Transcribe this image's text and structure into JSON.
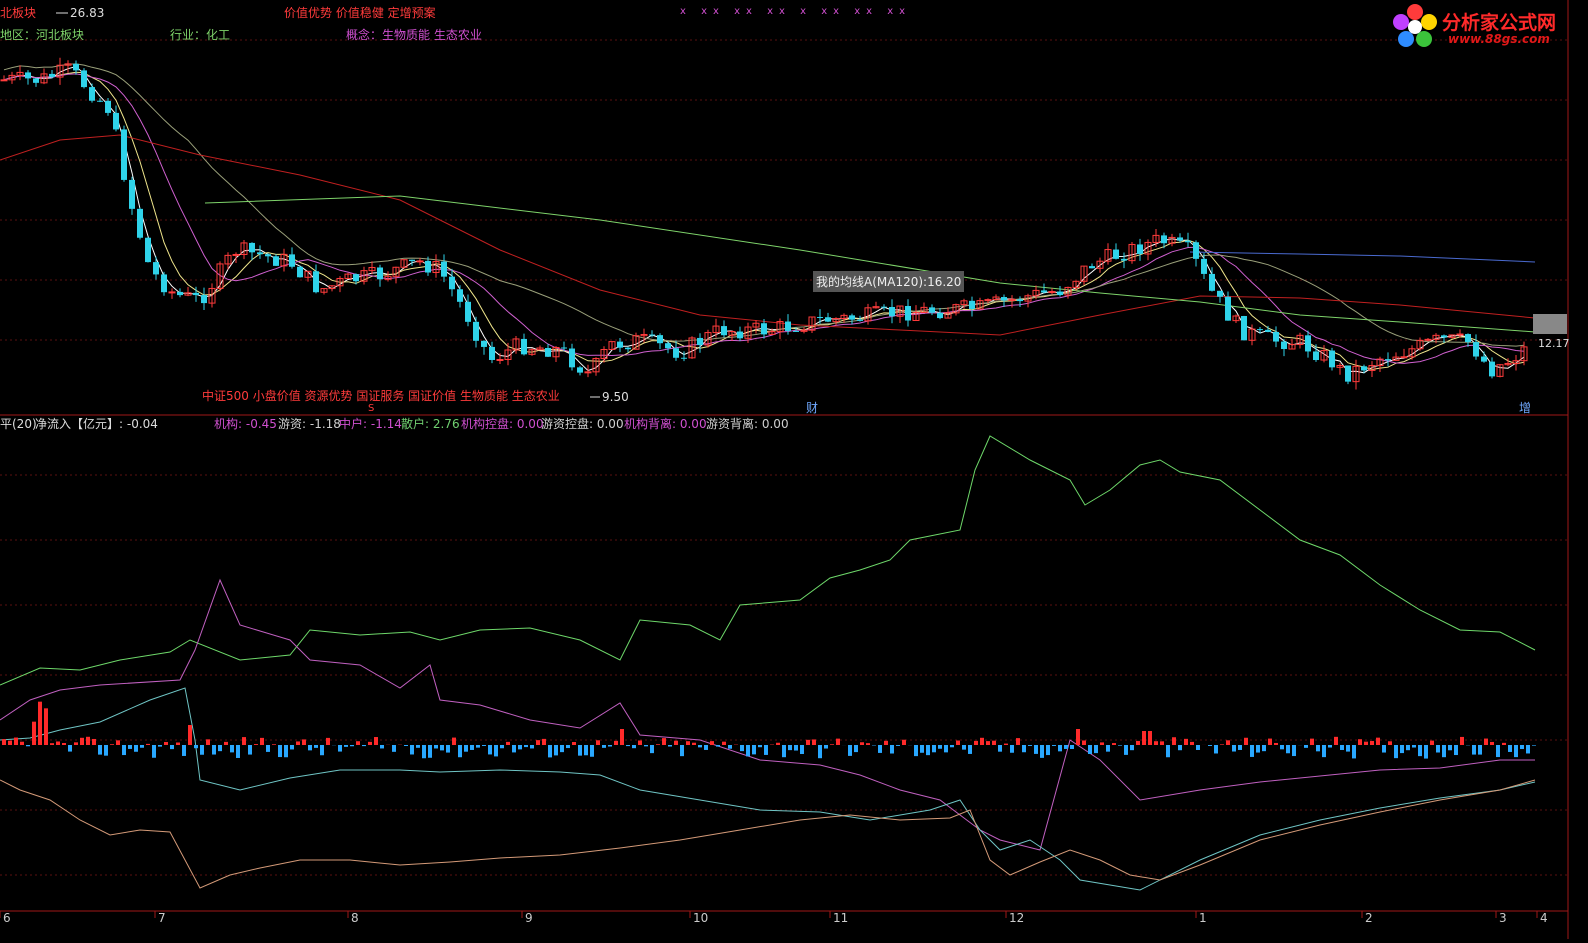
{
  "header": {
    "region_badge": "北板块",
    "price_high_label": "26.83",
    "concept_tags": "价值优势 价值稳健 定增预案",
    "region": "地区：河北板块",
    "industry": "行业：化工",
    "concept": "概念：生物质能 生态农业",
    "marks": "x  xx  xx xx  x xx  xx xx"
  },
  "logo": {
    "title": "分析家公式网",
    "url": "www.88gs.com"
  },
  "price_panel": {
    "ma_tooltip": "我的均线A(MA120):16.20",
    "low_label": "9.50",
    "last_price_label": "12.17",
    "index_tags": "中证500 小盘价值 资源优势 国证服务 国证价值 生物质能 生态农业",
    "event_mark_s": "S",
    "event_mark_cai": "财",
    "event_mark_tui": "增",
    "colors": {
      "bg": "#000000",
      "up": "#ff3b3b",
      "down": "#2fd3ea",
      "ma_white": "#ffffff",
      "ma_yellow": "#f0e68c",
      "ma_magenta": "#d060d0",
      "ma_green": "#7ed36a",
      "ma_red": "#c02020",
      "ma_blue": "#4a6ad0"
    }
  },
  "indicator_panel": {
    "title_prefix": "平(20)",
    "net_inflow": "净流入【亿元】: -0.04",
    "jigou": "机构: -0.45",
    "youzi": "游资: -1.18",
    "zhonghu": "中户: -1.14",
    "sanhu": "散户: 2.76",
    "jigou_kongpan": "机构控盘: 0.00",
    "youzi_kongpan": "游资控盘: 0.00",
    "jigou_beili": "机构背离: 0.00",
    "youzi_beili": "游资背离: 0.00",
    "colors": {
      "jigou": "#d050d0",
      "youzi": "#d0d0d0",
      "zhonghu": "#d050d0",
      "sanhu": "#70d070",
      "jigou_kongpan": "#d050d0",
      "youzi_kongpan": "#d0d0d0",
      "jigou_beili": "#d050d0",
      "youzi_beili": "#d0d0d0",
      "line_green": "#6ed86a",
      "line_magenta": "#c060c0",
      "line_cyan": "#6fc5c5",
      "line_orange": "#d49a78",
      "bar_up": "#ff2a2a",
      "bar_down": "#29a8ff"
    }
  },
  "chart_data": {
    "type": "candlestick-with-indicator",
    "x_ticks": [
      "6",
      "7",
      "8",
      "9",
      "10",
      "11",
      "12",
      "1",
      "2",
      "3",
      "4"
    ],
    "price_axis_marks": {
      "high": 26.83,
      "low": 9.5,
      "last": 12.17,
      "ma120": 16.2
    }
  }
}
